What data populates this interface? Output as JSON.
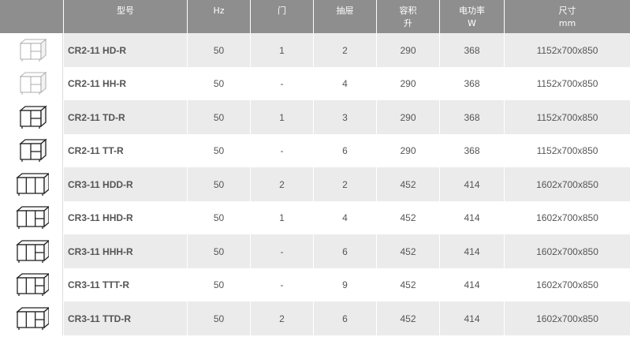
{
  "header": {
    "model": "型号",
    "hz": "Hz",
    "door": "门",
    "drawer": "抽屉",
    "volume": "容积",
    "volume_unit": "升",
    "power": "电功率",
    "power_unit": "W",
    "size": "尺寸",
    "size_unit": "mm"
  },
  "rows": [
    {
      "model": "CR2-11 HD-R",
      "hz": "50",
      "door": "1",
      "drawer": "2",
      "volume": "290",
      "power": "368",
      "size": "1152x700x850",
      "icon": "counter-fridge-2-section-door-drawer-icon"
    },
    {
      "model": "CR2-11 HH-R",
      "hz": "50",
      "door": "-",
      "drawer": "4",
      "volume": "290",
      "power": "368",
      "size": "1152x700x850",
      "icon": "counter-fridge-2-section-drawers-icon"
    },
    {
      "model": "CR2-11 TD-R",
      "hz": "50",
      "door": "1",
      "drawer": "3",
      "volume": "290",
      "power": "368",
      "size": "1152x700x850",
      "icon": "counter-fridge-2-section-door-drawer-icon"
    },
    {
      "model": "CR2-11 TT-R",
      "hz": "50",
      "door": "-",
      "drawer": "6",
      "volume": "290",
      "power": "368",
      "size": "1152x700x850",
      "icon": "counter-fridge-2-section-drawers-icon"
    },
    {
      "model": "CR3-11 HDD-R",
      "hz": "50",
      "door": "2",
      "drawer": "2",
      "volume": "452",
      "power": "414",
      "size": "1602x700x850",
      "icon": "counter-fridge-3-section-doors-icon"
    },
    {
      "model": "CR3-11 HHD-R",
      "hz": "50",
      "door": "1",
      "drawer": "4",
      "volume": "452",
      "power": "414",
      "size": "1602x700x850",
      "icon": "counter-fridge-3-section-door-drawers-icon"
    },
    {
      "model": "CR3-11 HHH-R",
      "hz": "50",
      "door": "-",
      "drawer": "6",
      "volume": "452",
      "power": "414",
      "size": "1602x700x850",
      "icon": "counter-fridge-3-section-drawers-icon"
    },
    {
      "model": "CR3-11 TTT-R",
      "hz": "50",
      "door": "-",
      "drawer": "9",
      "volume": "452",
      "power": "414",
      "size": "1602x700x850",
      "icon": "counter-fridge-3-section-drawers-icon"
    },
    {
      "model": "CR3-11 TTD-R",
      "hz": "50",
      "door": "2",
      "drawer": "6",
      "volume": "452",
      "power": "414",
      "size": "1602x700x850",
      "icon": "counter-fridge-3-section-door-drawers-icon"
    }
  ]
}
